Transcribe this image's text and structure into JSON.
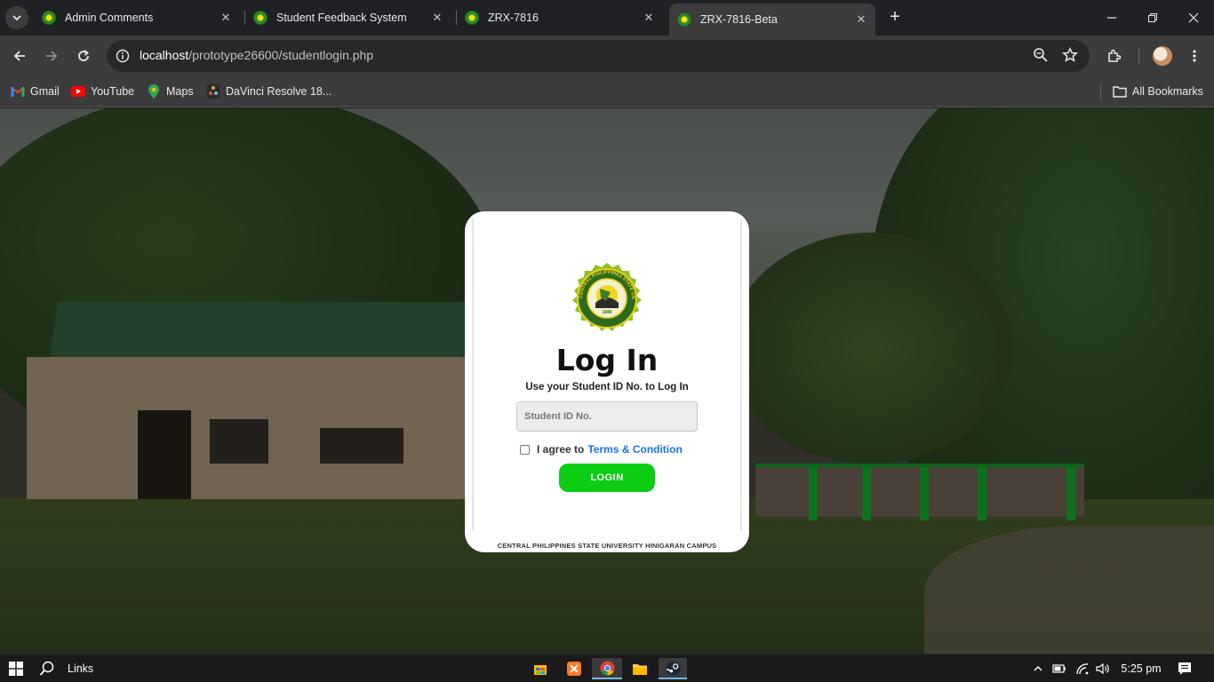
{
  "browser": {
    "tabs": [
      {
        "title": "Admin Comments",
        "active": false
      },
      {
        "title": "Student Feedback System",
        "active": false
      },
      {
        "title": "ZRX-7816",
        "active": false
      },
      {
        "title": "ZRX-7816-Beta",
        "active": true
      }
    ],
    "url_host": "localhost",
    "url_path": "/prototype26600/studentlogin.php",
    "bookmarks": [
      {
        "label": "Gmail",
        "icon": "gmail-icon"
      },
      {
        "label": "YouTube",
        "icon": "youtube-icon"
      },
      {
        "label": "Maps",
        "icon": "maps-icon"
      },
      {
        "label": "DaVinci Resolve 18...",
        "icon": "davinci-icon"
      }
    ],
    "all_bookmarks_label": "All Bookmarks"
  },
  "login": {
    "title": "Log In",
    "subtitle": "Use your Student ID No. to Log In",
    "id_placeholder": "Student ID No.",
    "agree_text": "I agree to",
    "terms_link": "Terms & Condition",
    "agree_checked": false,
    "button_label": "LOGIN",
    "footer": "CENTRAL PHILIPPINES STATE UNIVERSITY HINIGARAN CAMPUS",
    "seal_text": "CENTRAL PHILIPPINES STATE UNIVERSITY",
    "seal_year": "1946"
  },
  "taskbar": {
    "search_label": "Links",
    "time": "5:25 pm",
    "apps": [
      "store-icon",
      "xampp-icon",
      "chrome-icon",
      "file-explorer-icon",
      "steam-icon"
    ]
  },
  "colors": {
    "accent_green": "#0ccd13",
    "link_blue": "#1a73e8",
    "chrome_dark": "#202124"
  }
}
